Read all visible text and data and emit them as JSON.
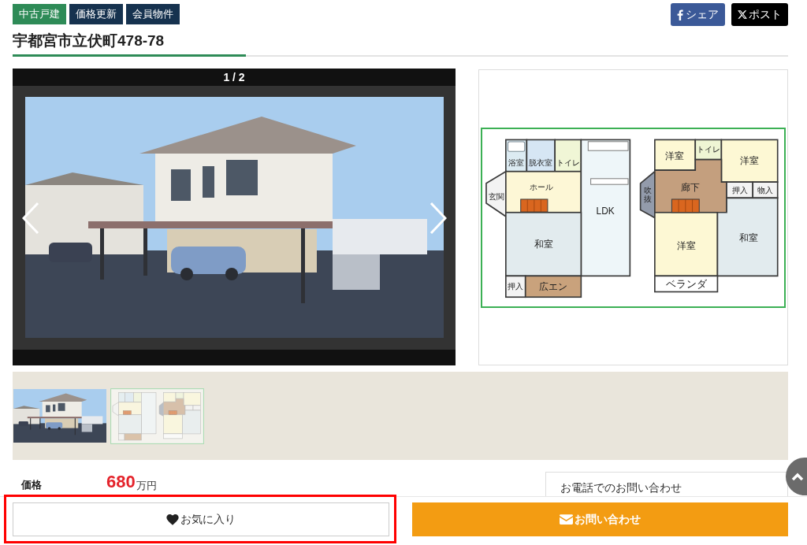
{
  "tags": [
    {
      "label": "中古戸建",
      "kind": "type"
    },
    {
      "label": "価格更新",
      "kind": "status"
    },
    {
      "label": "会員物件",
      "kind": "status"
    }
  ],
  "share_buttons": [
    {
      "label": "シェア",
      "kind": "facebook"
    },
    {
      "label": "ポスト",
      "kind": "x"
    }
  ],
  "title": "宇都宮市立伏町478-78",
  "gallery": {
    "counter": "1 / 2"
  },
  "floor_plan": {
    "floors": [
      {
        "rooms": [
          {
            "label": "浴室",
            "color": "#dcebf2"
          },
          {
            "label": "脱衣室",
            "color": "#d6e6f4"
          },
          {
            "label": "トイレ",
            "color": "#f0f6d6"
          },
          {
            "label": "玄関",
            "color": "#f3f3f3"
          },
          {
            "label": "ホール",
            "color": "#fdf7d6"
          },
          {
            "label": "LDK",
            "color": "#eef6f9"
          },
          {
            "label": "和室",
            "color": "#e2ebee"
          },
          {
            "label": "押入",
            "color": "#f3f3f3"
          },
          {
            "label": "広エン",
            "color": "#c9a27c"
          }
        ]
      },
      {
        "rooms": [
          {
            "label": "洋室",
            "color": "#fdf8d4"
          },
          {
            "label": "トイレ",
            "color": "#eef5d4"
          },
          {
            "label": "洋室",
            "color": "#fdf8d4"
          },
          {
            "label": "吹抜",
            "color": "#939bab"
          },
          {
            "label": "廊下",
            "color": "#c49f7e"
          },
          {
            "label": "押入",
            "color": "#f3f3f3"
          },
          {
            "label": "物入",
            "color": "#f3f3f3"
          },
          {
            "label": "洋室",
            "color": "#fdf8d4"
          },
          {
            "label": "和室",
            "color": "#e2ebee"
          },
          {
            "label": "ベランダ",
            "color": "#ffffff"
          }
        ]
      }
    ]
  },
  "thumbnails": [
    {
      "kind": "photo"
    },
    {
      "kind": "floorplan"
    }
  ],
  "price": {
    "label": "価格",
    "amount": "680",
    "unit": "万円"
  },
  "contact_box": {
    "title": "お電話でのお問い合わせ"
  },
  "bottom_bar": {
    "buttons": [
      {
        "label": "お気に入り",
        "kind": "favorite",
        "highlighted": true
      },
      {
        "label": "お問い合わせ",
        "kind": "contact",
        "highlighted": false
      }
    ]
  }
}
